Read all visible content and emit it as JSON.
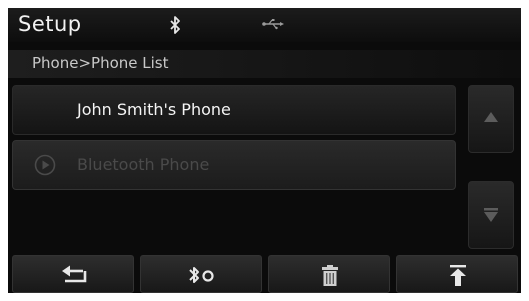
{
  "header": {
    "title": "Setup",
    "status_icons": [
      "bluetooth-icon",
      "usb-icon"
    ]
  },
  "breadcrumb": {
    "text": "Phone>Phone List"
  },
  "phone_list": {
    "items": [
      {
        "label": "John Smith's Phone",
        "state": "active"
      },
      {
        "label": "Bluetooth Phone",
        "state": "dimmed",
        "icon": "play-circle-icon"
      }
    ]
  },
  "scroll": {
    "up_icon": "triangle-up-icon",
    "down_icon": "bar-triangle-down-icon"
  },
  "toolbar": {
    "buttons": [
      "back-arrow-icon",
      "bluetooth-disconnect-icon",
      "trash-icon",
      "move-to-top-icon"
    ]
  },
  "colors": {
    "background": "#0b0b0b",
    "text_primary": "#f4f4f4",
    "text_dimmed": "#4a4a4a",
    "breadcrumb_text": "#c8c8c8"
  }
}
